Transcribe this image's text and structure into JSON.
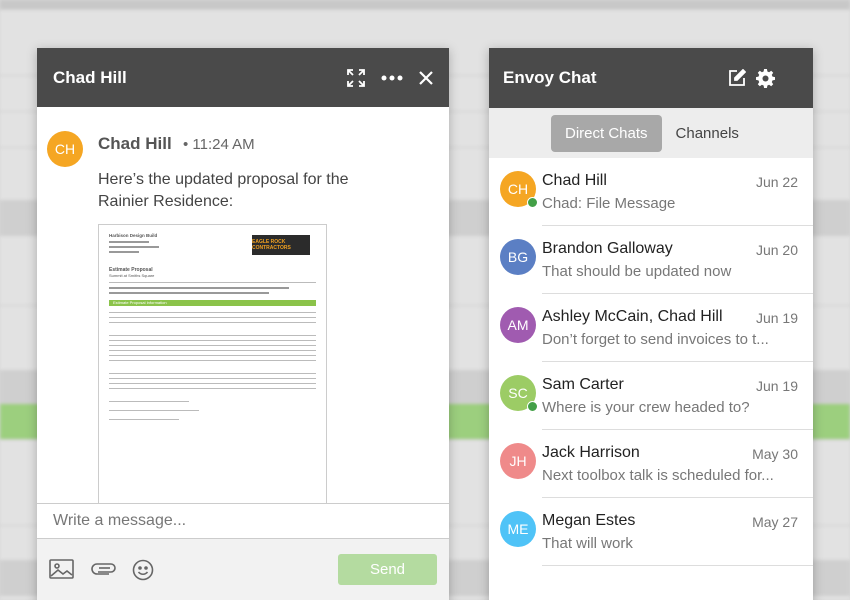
{
  "chat_window": {
    "title": "Chad Hill",
    "message": {
      "avatar_initials": "CH",
      "avatar_color": "#f5a623",
      "sender": "Chad Hill",
      "time": "• 11:24 AM",
      "text": "Here’s the updated proposal for the Rainier Residence:",
      "attachment": {
        "company": "Harbison Design Build",
        "logo_text": "EAGLE ROCK CONTRACTORS",
        "doc_title": "Estimate Proposal",
        "doc_subtitle": "Summit at Smiths Square",
        "section": "Estimate Proposal Information"
      }
    },
    "composer_placeholder": "Write a message...",
    "send_label": "Send",
    "send_color": "#b4dba0"
  },
  "envoy": {
    "title": "Envoy Chat",
    "tabs": [
      {
        "label": "Direct Chats",
        "active": true
      },
      {
        "label": "Channels",
        "active": false
      }
    ],
    "conversations": [
      {
        "initials": "CH",
        "color": "#f5a623",
        "name": "Chad Hill",
        "date": "Jun 22",
        "preview": "Chad: File Message",
        "online": true
      },
      {
        "initials": "BG",
        "color": "#5b7fc4",
        "name": "Brandon Galloway",
        "date": "Jun 20",
        "preview": "That should be updated now",
        "online": false
      },
      {
        "initials": "AM",
        "color": "#a05bb0",
        "name": "Ashley McCain, Chad Hill",
        "date": "Jun 19",
        "preview": "Don’t forget to send invoices to t...",
        "online": false
      },
      {
        "initials": "SC",
        "color": "#9ccc65",
        "name": "Sam Carter",
        "date": "Jun 19",
        "preview": "Where is your crew headed to?",
        "online": true
      },
      {
        "initials": "JH",
        "color": "#ef8a8a",
        "name": "Jack Harrison",
        "date": "May 30",
        "preview": "Next toolbox talk is scheduled for...",
        "online": false
      },
      {
        "initials": "ME",
        "color": "#4fc3f7",
        "name": "Megan Estes",
        "date": "May 27",
        "preview": "That will work",
        "online": false
      }
    ]
  }
}
